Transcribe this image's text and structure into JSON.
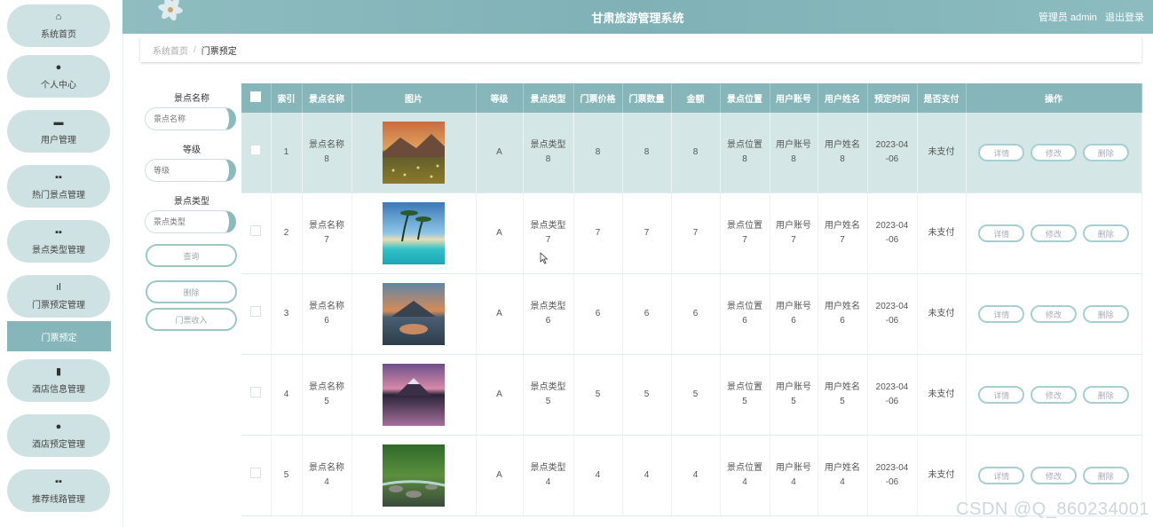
{
  "app_title": "甘肃旅游管理系统",
  "header": {
    "user_label": "管理员 admin",
    "logout_label": "退出登录"
  },
  "sidebar": {
    "items": [
      {
        "label": "系统首页",
        "icon": "home-icon",
        "glyph": "⌂"
      },
      {
        "label": "个人中心",
        "icon": "user-icon",
        "glyph": "●"
      },
      {
        "label": "用户管理",
        "icon": "briefcase-icon",
        "glyph": "▬"
      },
      {
        "label": "热门景点管理",
        "icon": "grid-icon",
        "glyph": "▪▪"
      },
      {
        "label": "景点类型管理",
        "icon": "grid-icon",
        "glyph": "▪▪"
      },
      {
        "label": "门票预定管理",
        "icon": "bar-chart-icon",
        "glyph": "ıl"
      },
      {
        "label": "酒店信息管理",
        "icon": "document-icon",
        "glyph": "▮"
      },
      {
        "label": "酒店预定管理",
        "icon": "map-pin-icon",
        "glyph": "●"
      },
      {
        "label": "推荐线路管理",
        "icon": "grid-icon",
        "glyph": "▪▪"
      }
    ],
    "active_sub": "门票预定"
  },
  "breadcrumb": {
    "home": "系统首页",
    "separator": "/",
    "current": "门票预定"
  },
  "search": {
    "name_label": "景点名称",
    "name_placeholder": "景点名称",
    "level_label": "等级",
    "level_placeholder": "等级",
    "type_label": "景点类型",
    "type_placeholder": "景点类型",
    "query_button": "查询",
    "delete_button": "删除",
    "income_button": "门票收入"
  },
  "table": {
    "headers": [
      "索引",
      "景点名称",
      "图片",
      "等级",
      "景点类型",
      "门票价格",
      "门票数量",
      "金额",
      "景点位置",
      "用户账号",
      "用户姓名",
      "预定时间",
      "是否支付",
      "操作"
    ],
    "rows": [
      {
        "index": "1",
        "name": [
          "景点名称",
          "8"
        ],
        "level": "A",
        "type": [
          "景点类型",
          "8"
        ],
        "price": "8",
        "qty": "8",
        "amount": "8",
        "location": [
          "景点位置",
          "8"
        ],
        "account": [
          "用户账号",
          "8"
        ],
        "username": [
          "用户姓名",
          "8"
        ],
        "time": [
          "2023-04",
          "-06"
        ],
        "paid": "未支付"
      },
      {
        "index": "2",
        "name": [
          "景点名称",
          "7"
        ],
        "level": "A",
        "type": [
          "景点类型",
          "7"
        ],
        "price": "7",
        "qty": "7",
        "amount": "7",
        "location": [
          "景点位置",
          "7"
        ],
        "account": [
          "用户账号",
          "7"
        ],
        "username": [
          "用户姓名",
          "7"
        ],
        "time": [
          "2023-04",
          "-06"
        ],
        "paid": "未支付"
      },
      {
        "index": "3",
        "name": [
          "景点名称",
          "6"
        ],
        "level": "A",
        "type": [
          "景点类型",
          "6"
        ],
        "price": "6",
        "qty": "6",
        "amount": "6",
        "location": [
          "景点位置",
          "6"
        ],
        "account": [
          "用户账号",
          "6"
        ],
        "username": [
          "用户姓名",
          "6"
        ],
        "time": [
          "2023-04",
          "-06"
        ],
        "paid": "未支付"
      },
      {
        "index": "4",
        "name": [
          "景点名称",
          "5"
        ],
        "level": "A",
        "type": [
          "景点类型",
          "5"
        ],
        "price": "5",
        "qty": "5",
        "amount": "5",
        "location": [
          "景点位置",
          "5"
        ],
        "account": [
          "用户账号",
          "5"
        ],
        "username": [
          "用户姓名",
          "5"
        ],
        "time": [
          "2023-04",
          "-06"
        ],
        "paid": "未支付"
      },
      {
        "index": "5",
        "name": [
          "景点名称",
          "4"
        ],
        "level": "A",
        "type": [
          "景点类型",
          "4"
        ],
        "price": "4",
        "qty": "4",
        "amount": "4",
        "location": [
          "景点位置",
          "4"
        ],
        "account": [
          "用户账号",
          "4"
        ],
        "username": [
          "用户姓名",
          "4"
        ],
        "time": [
          "2023-04",
          "-06"
        ],
        "paid": "未支付"
      }
    ],
    "actions": {
      "detail": "详情",
      "edit": "修改",
      "delete": "删除"
    }
  },
  "colors": {
    "accent": "#86b6b9",
    "nav_bg": "#cfe2e3",
    "highlight_row": "#d4e6e6"
  },
  "watermark": "CSDN @Q_860234001"
}
